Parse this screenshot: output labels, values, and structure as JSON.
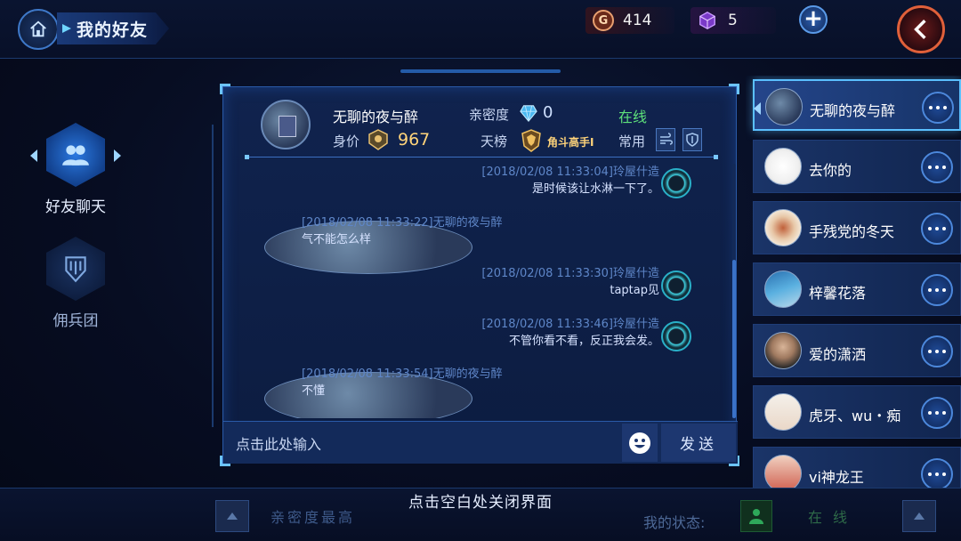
{
  "header": {
    "title": "我的好友",
    "gold": "414",
    "gold_symbol": "G",
    "gems": "5"
  },
  "leftnav": {
    "items": [
      {
        "label": "好友聊天",
        "icon": "friends-icon",
        "active": true
      },
      {
        "label": "佣兵团",
        "icon": "guild-icon",
        "active": false
      }
    ]
  },
  "profile": {
    "name": "无聊的夜与醉",
    "price_label": "身价",
    "price_value": "967",
    "intimacy_label": "亲密度",
    "intimacy_value": "0",
    "status": "在线",
    "rank_label": "天榜",
    "rank_value": "角斗高手I",
    "common_label": "常用"
  },
  "messages": [
    {
      "side": "right",
      "meta": "[2018/02/08    11:33:04]玲屋什造",
      "text": "是时候该让水淋一下了。"
    },
    {
      "side": "left",
      "meta": "[2018/02/08    11:33:22]无聊的夜与醉",
      "text": "气不能怎么样"
    },
    {
      "side": "right",
      "meta": "[2018/02/08    11:33:30]玲屋什造",
      "text": "taptap见"
    },
    {
      "side": "right",
      "meta": "[2018/02/08    11:33:46]玲屋什造",
      "text": "不管你看不看，反正我会发。"
    },
    {
      "side": "left",
      "meta": "[2018/02/08    11:33:54]无聊的夜与醉",
      "text": "不懂"
    }
  ],
  "input": {
    "placeholder": "点击此处输入",
    "send_label": "发送"
  },
  "friends": [
    {
      "name": "无聊的夜与醉",
      "selected": true
    },
    {
      "name": "去你的",
      "selected": false
    },
    {
      "name": "手残党的冬天",
      "selected": false
    },
    {
      "name": "梓馨花落",
      "selected": false
    },
    {
      "name": "爱的潇洒",
      "selected": false
    },
    {
      "name": "虎牙、wu・痴",
      "selected": false
    },
    {
      "name": "vi神龙王",
      "selected": false
    }
  ],
  "bottom": {
    "close_hint": "点击空白处关闭界面",
    "sort_label": "亲密度最高",
    "my_status_label": "我的状态:",
    "my_status_value": "在线"
  },
  "colors": {
    "accent": "#5bc0ff",
    "online": "#5ee07a",
    "gold_text": "#ffd47a"
  }
}
